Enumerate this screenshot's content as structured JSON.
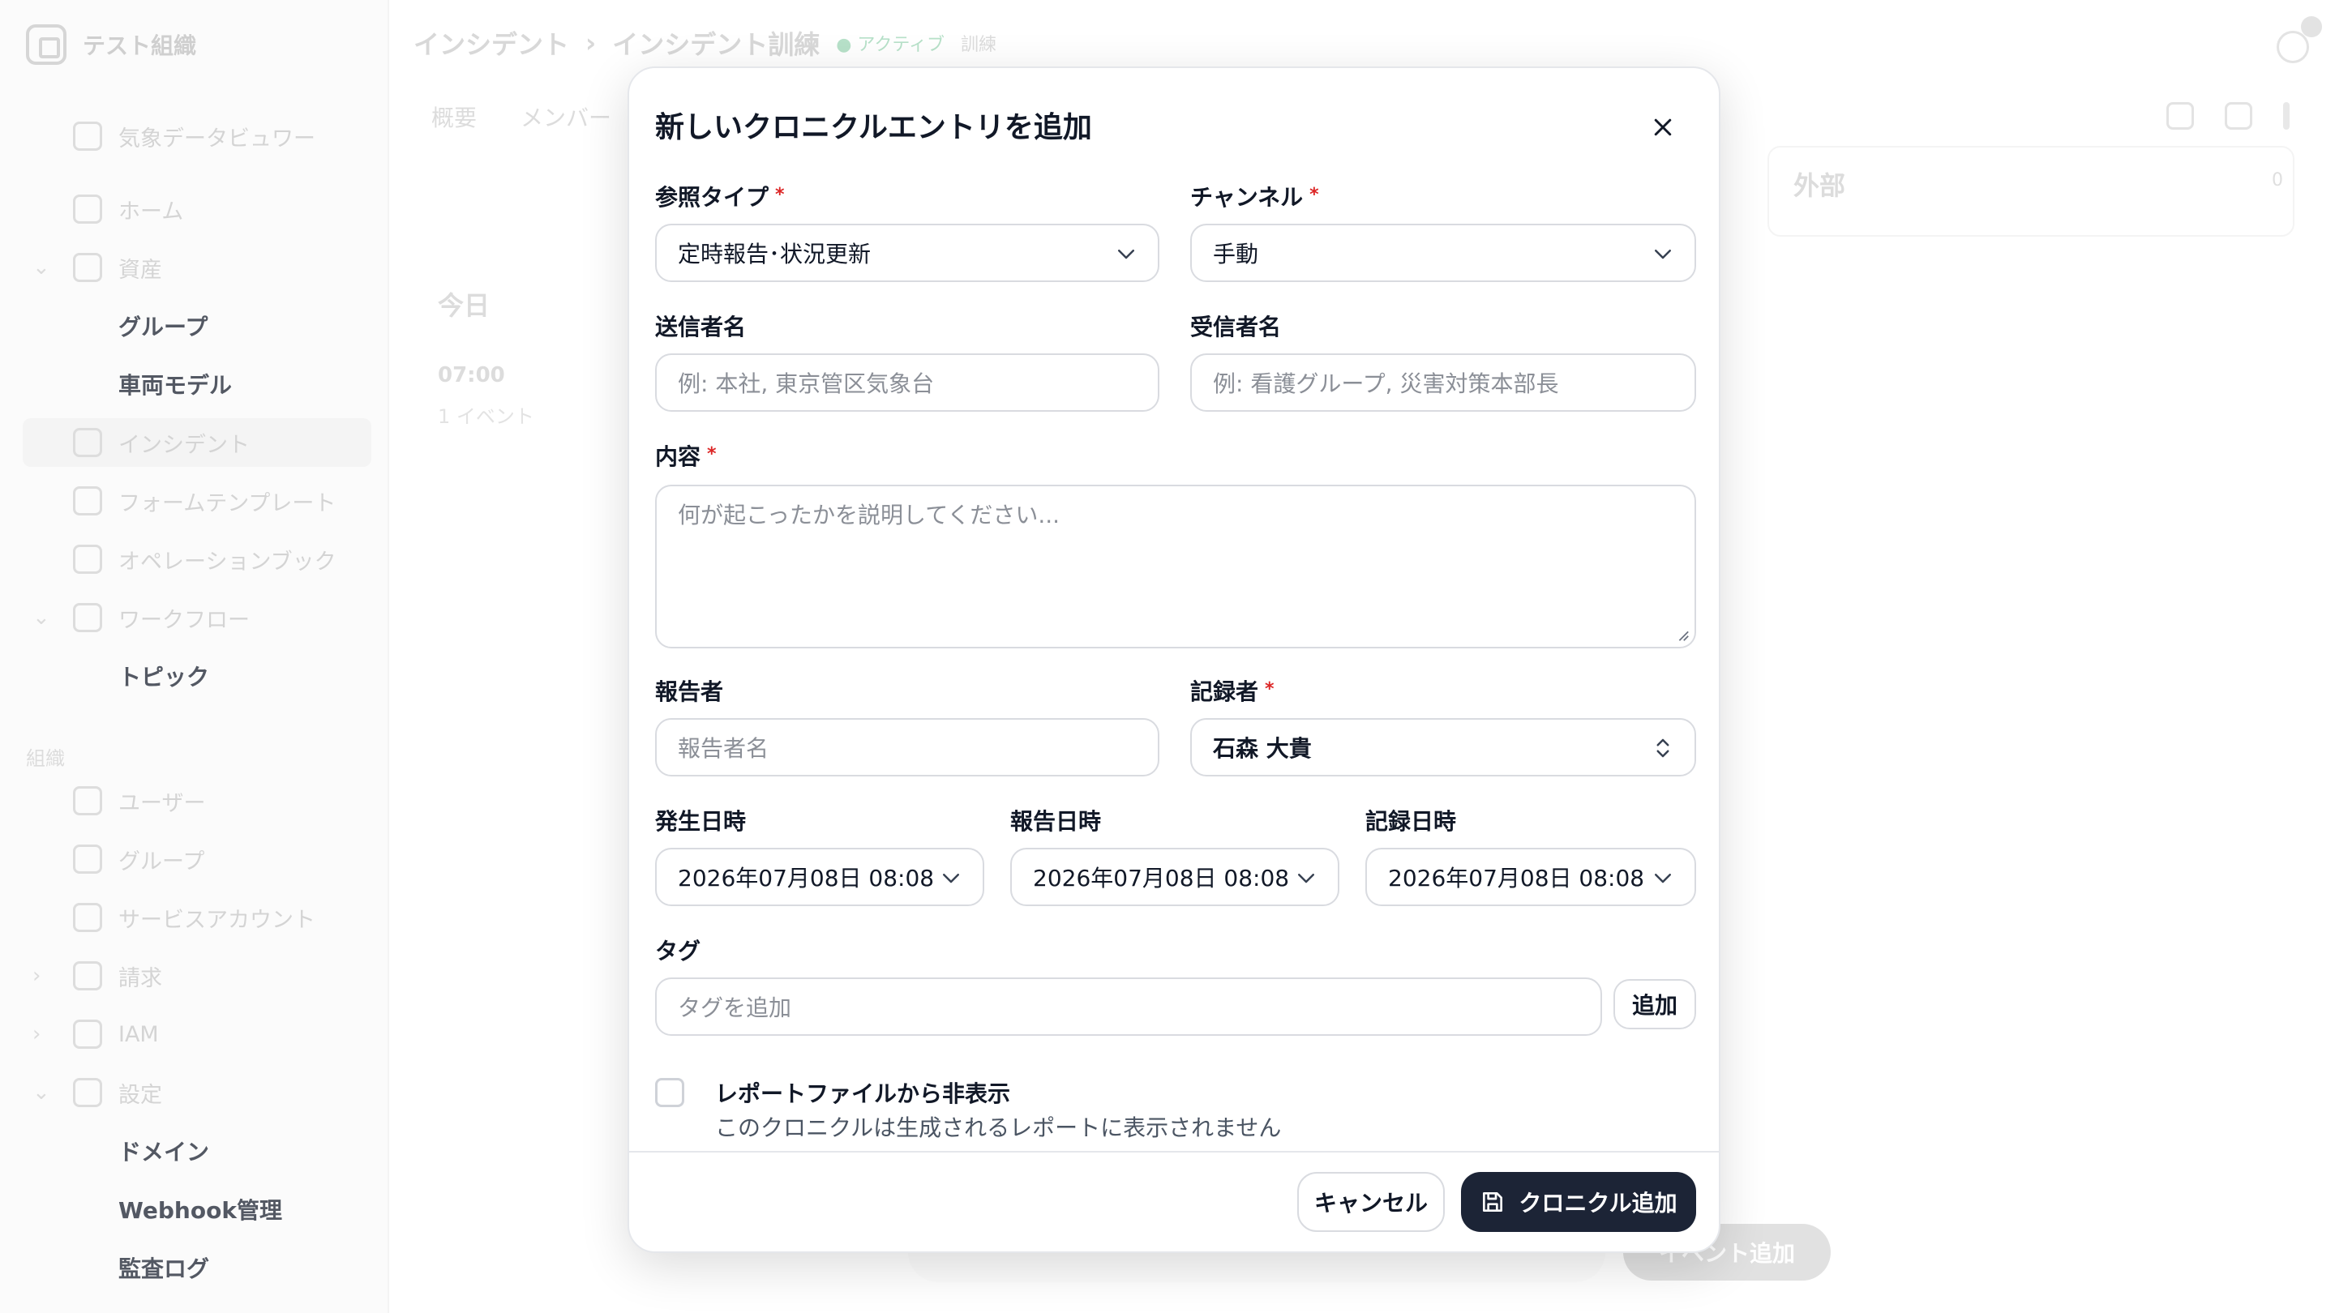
{
  "background": {
    "org_name": "テスト組織",
    "sidebar": {
      "top_item": "気象データビュワー",
      "items": [
        "ホーム",
        "資産",
        "グループ",
        "車両モデル",
        "インシデント",
        "フォームテンプレート",
        "オペレーションブック",
        "ワークフロー",
        "トピック"
      ],
      "section_label": "組織",
      "org_items": [
        "ユーザー",
        "グループ",
        "サービスアカウント",
        "請求",
        "IAM",
        "設定",
        "ドメイン",
        "Webhook管理",
        "監査ログ"
      ]
    },
    "breadcrumb": [
      "インシデント",
      "インシデント訓練"
    ],
    "status_badge": "アクティブ",
    "type_badge": "訓練",
    "tabs": [
      "概要",
      "メンバー"
    ],
    "today_label": "今日",
    "time_label": "07:00",
    "event_count": "1 イベント",
    "external_card_title": "外部",
    "external_card_count": "0",
    "add_event_button": "イベント追加"
  },
  "modal": {
    "title": "新しいクロニクルエントリを追加",
    "reference_type": {
      "label": "参照タイプ",
      "required": "*",
      "value": "定時報告･状況更新"
    },
    "channel": {
      "label": "チャンネル",
      "required": "*",
      "value": "手動"
    },
    "sender": {
      "label": "送信者名",
      "placeholder": "例: 本社, 東京管区気象台"
    },
    "receiver": {
      "label": "受信者名",
      "placeholder": "例: 看護グループ, 災害対策本部長"
    },
    "content": {
      "label": "内容",
      "required": "*",
      "placeholder": "何が起こったかを説明してください..."
    },
    "reporter": {
      "label": "報告者",
      "placeholder": "報告者名"
    },
    "recorder": {
      "label": "記録者",
      "required": "*",
      "value": "石森 大貴"
    },
    "occurred_at": {
      "label": "発生日時",
      "value": "2026年07月08日 08:08"
    },
    "reported_at": {
      "label": "報告日時",
      "value": "2026年07月08日 08:08"
    },
    "recorded_at": {
      "label": "記録日時",
      "value": "2026年07月08日 08:08"
    },
    "tags": {
      "label": "タグ",
      "placeholder": "タグを追加",
      "add_button": "追加"
    },
    "hide_from_report": {
      "label": "レポートファイルから非表示",
      "description": "このクロニクルは生成されるレポートに表示されません",
      "checked": false
    },
    "cancel_button": "キャンセル",
    "submit_button": "クロニクル追加"
  },
  "colors": {
    "primary_button": "#1c2436",
    "required": "#dc2626",
    "active_badge": "#22c55e"
  }
}
